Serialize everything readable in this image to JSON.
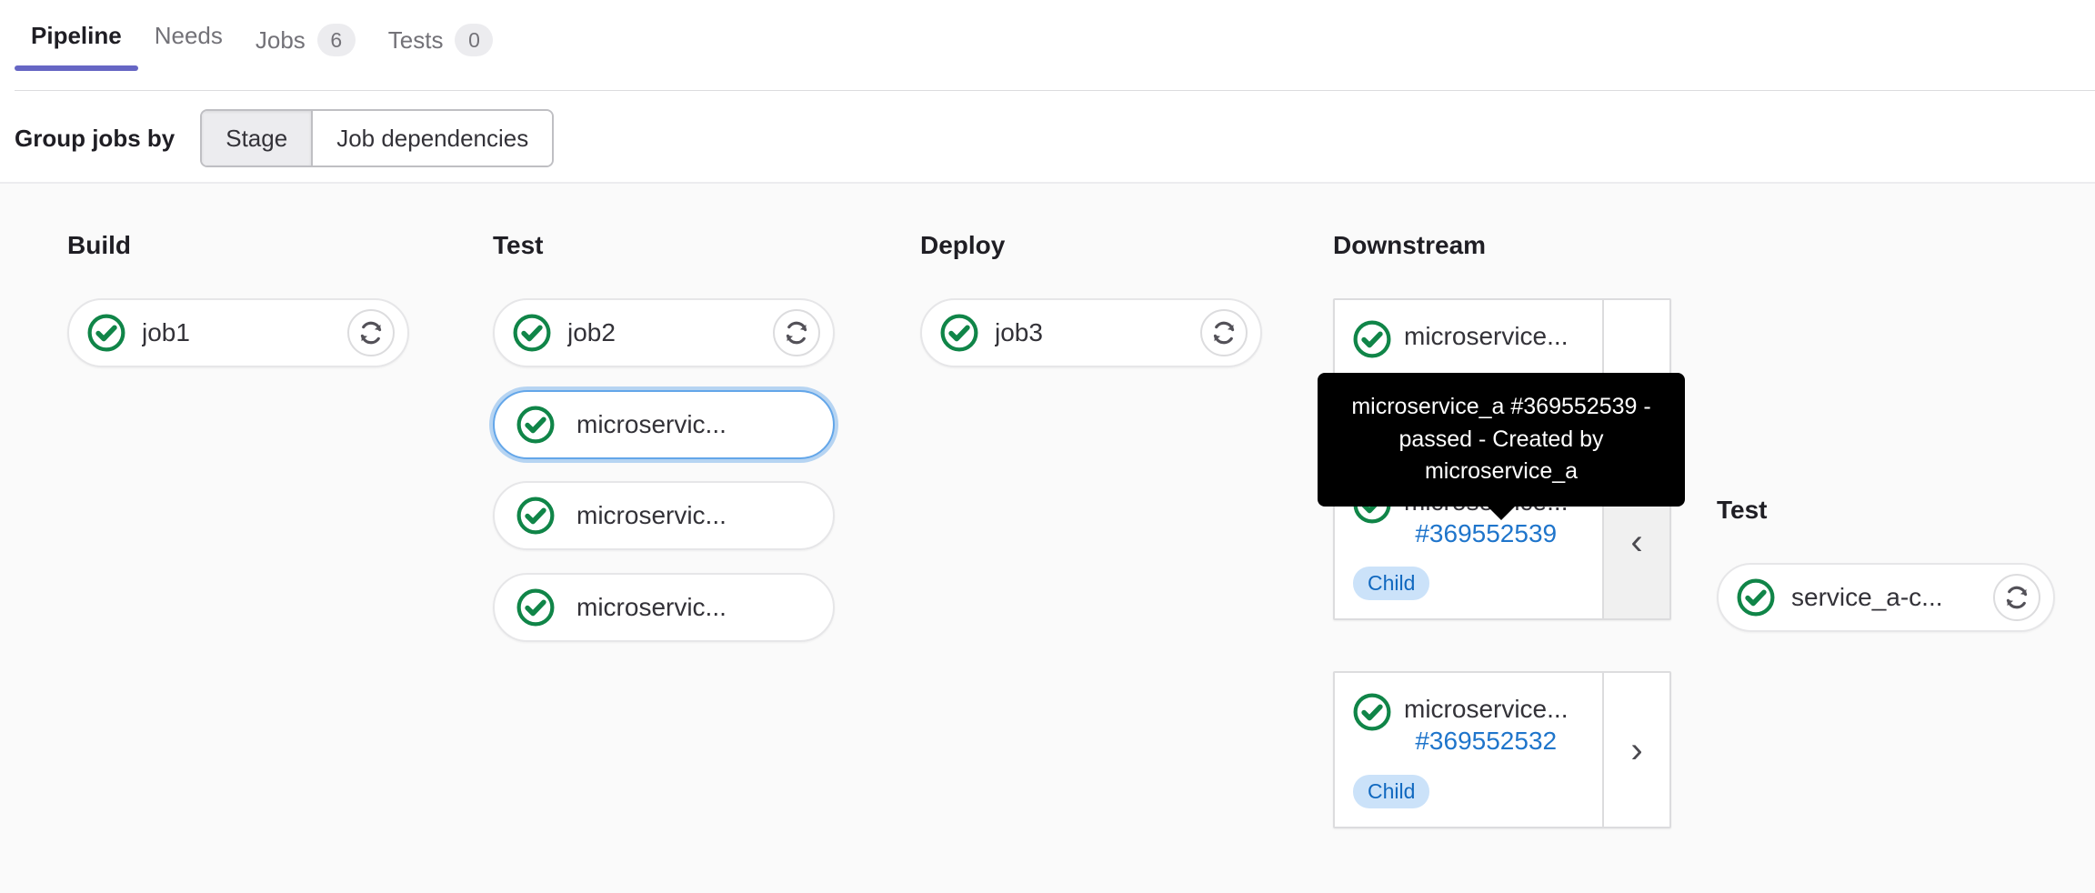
{
  "tabs": [
    {
      "label": "Pipeline",
      "count": null,
      "active": true
    },
    {
      "label": "Needs",
      "count": null,
      "active": false
    },
    {
      "label": "Jobs",
      "count": "6",
      "active": false
    },
    {
      "label": "Tests",
      "count": "0",
      "active": false
    }
  ],
  "toolbar": {
    "group_label": "Group jobs by",
    "option_stage": "Stage",
    "option_job_dependencies": "Job dependencies"
  },
  "colors": {
    "accent": "#6666c4",
    "success": "#108548",
    "link": "#1f75cb",
    "badge_bg": "#cbe2f9",
    "badge_text": "#1068bf",
    "canvas_bg": "#fafafa"
  },
  "stages": [
    {
      "title": "Build",
      "jobs": [
        {
          "name": "job1",
          "status": "passed",
          "retry": true,
          "focused": false
        }
      ]
    },
    {
      "title": "Test",
      "jobs": [
        {
          "name": "job2",
          "status": "passed",
          "retry": true,
          "focused": false
        },
        {
          "name": "microservic...",
          "status": "passed",
          "retry": false,
          "focused": true
        },
        {
          "name": "microservic...",
          "status": "passed",
          "retry": false,
          "focused": false
        },
        {
          "name": "microservic...",
          "status": "passed",
          "retry": false,
          "focused": false
        }
      ]
    },
    {
      "title": "Deploy",
      "jobs": [
        {
          "name": "job3",
          "status": "passed",
          "retry": true,
          "focused": false
        }
      ]
    }
  ],
  "downstream": {
    "title": "Downstream",
    "cards": [
      {
        "name": "microservice...",
        "pipeline_id": "",
        "badge": "",
        "status": "passed",
        "expanded": false,
        "chevron": "",
        "partial": true
      },
      {
        "name": "microservice...",
        "pipeline_id": "#369552539",
        "badge": "Child",
        "status": "passed",
        "expanded": true,
        "chevron": "‹",
        "partial": false
      },
      {
        "name": "microservice...",
        "pipeline_id": "#369552532",
        "badge": "Child",
        "status": "passed",
        "expanded": false,
        "chevron": "›",
        "partial": false
      }
    ]
  },
  "expanded_pipeline": {
    "stage_title": "Test",
    "jobs": [
      {
        "name": "service_a-c...",
        "status": "passed",
        "retry": true,
        "focused": false
      }
    ]
  },
  "tooltip": {
    "text": "microservice_a #369552539 - passed - Created by microservice_a"
  }
}
